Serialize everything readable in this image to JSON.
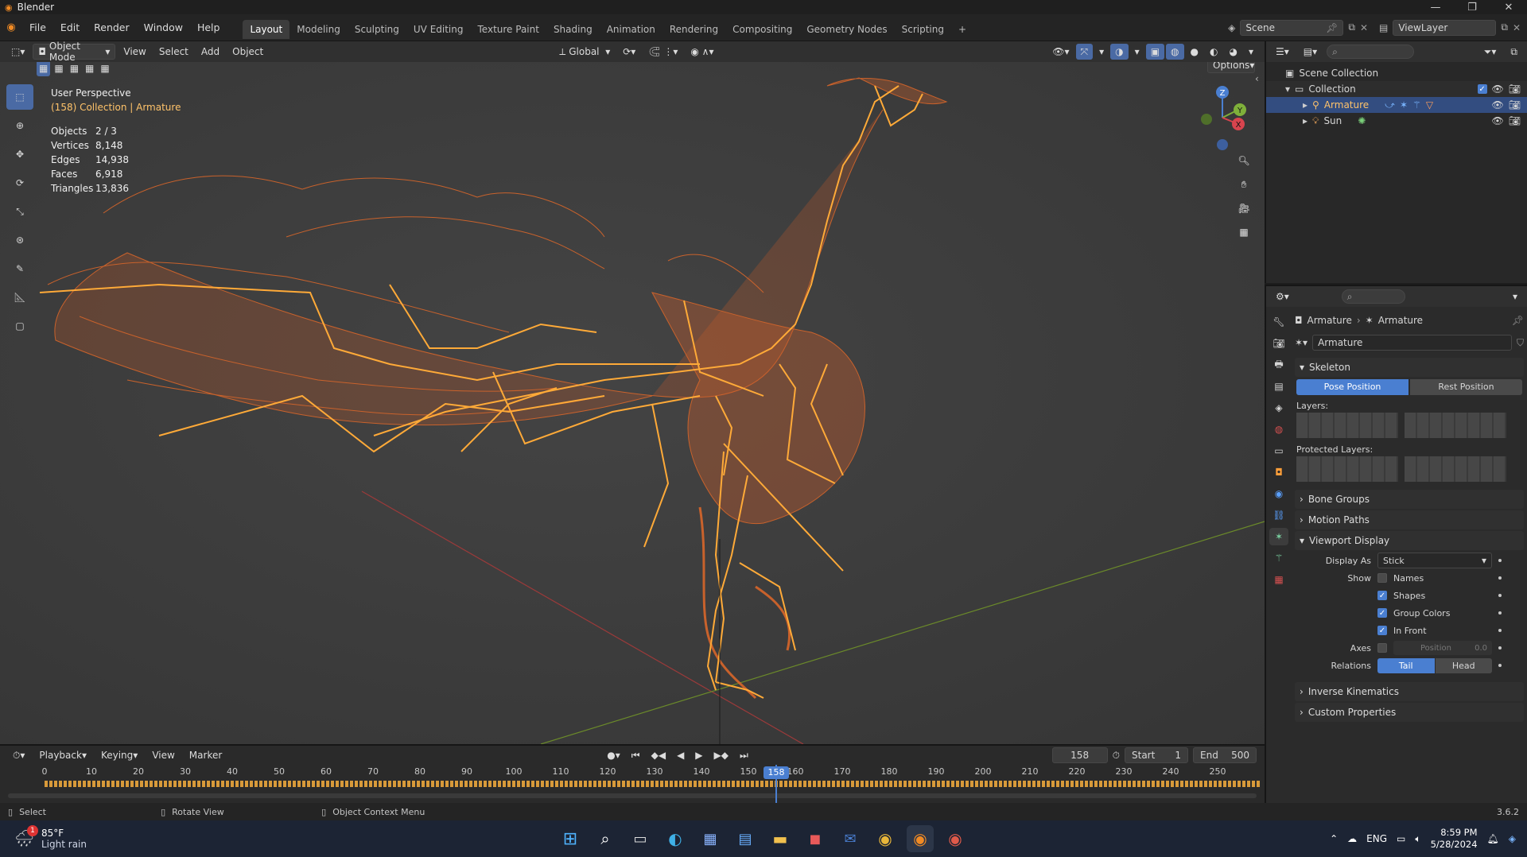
{
  "window": {
    "title": "Blender"
  },
  "menu": {
    "items": [
      "File",
      "Edit",
      "Render",
      "Window",
      "Help"
    ]
  },
  "workspaces": [
    "Layout",
    "Modeling",
    "Sculpting",
    "UV Editing",
    "Texture Paint",
    "Shading",
    "Animation",
    "Rendering",
    "Compositing",
    "Geometry Nodes",
    "Scripting"
  ],
  "scene": {
    "label": "Scene",
    "viewlayer": "ViewLayer"
  },
  "viewport_header": {
    "mode": "Object Mode",
    "view": "View",
    "select": "Select",
    "add": "Add",
    "object": "Object",
    "orientation": "Global",
    "options": "Options"
  },
  "overlay": {
    "title": "User Perspective",
    "context": "(158) Collection | Armature",
    "stats": [
      {
        "k": "Objects",
        "v": "2 / 3"
      },
      {
        "k": "Vertices",
        "v": "8,148"
      },
      {
        "k": "Edges",
        "v": "14,938"
      },
      {
        "k": "Faces",
        "v": "6,918"
      },
      {
        "k": "Triangles",
        "v": "13,836"
      }
    ]
  },
  "gizmo": {
    "z": "Z",
    "y": "Y",
    "x": "X"
  },
  "outliner": {
    "root": "Scene Collection",
    "collection": "Collection",
    "items": [
      {
        "name": "Armature",
        "selected": true
      },
      {
        "name": "Sun",
        "selected": false
      }
    ]
  },
  "properties": {
    "breadcrumb": [
      "Armature",
      "Armature"
    ],
    "data_name": "Armature",
    "skeleton": {
      "title": "Skeleton",
      "pose": "Pose Position",
      "rest": "Rest Position",
      "layers": "Layers:",
      "protected": "Protected Layers:"
    },
    "collapsed": [
      "Bone Groups",
      "Motion Paths"
    ],
    "viewport_display": {
      "title": "Viewport Display",
      "display_as_label": "Display As",
      "display_as": "Stick",
      "show_label": "Show",
      "checks": [
        {
          "label": "Names",
          "on": false
        },
        {
          "label": "Shapes",
          "on": true
        },
        {
          "label": "Group Colors",
          "on": true
        },
        {
          "label": "In Front",
          "on": true
        }
      ],
      "axes_label": "Axes",
      "axes_position_label": "Position",
      "axes_position_value": "0.0",
      "relations_label": "Relations",
      "tail": "Tail",
      "head": "Head"
    },
    "collapsed2": [
      "Inverse Kinematics",
      "Custom Properties"
    ]
  },
  "timeline": {
    "menus": [
      "Playback",
      "Keying",
      "View",
      "Marker"
    ],
    "current": "158",
    "start_label": "Start",
    "start": "1",
    "end_label": "End",
    "end": "500",
    "ticks": [
      "0",
      "10",
      "20",
      "30",
      "40",
      "50",
      "60",
      "70",
      "80",
      "90",
      "100",
      "110",
      "120",
      "130",
      "140",
      "150",
      "160",
      "170",
      "180",
      "190",
      "200",
      "210",
      "220",
      "230",
      "240",
      "250"
    ],
    "playhead": "158"
  },
  "status": {
    "select": "Select",
    "rotate": "Rotate View",
    "context": "Object Context Menu",
    "version": "3.6.2"
  },
  "taskbar": {
    "temp": "85°F",
    "weather": "Light rain",
    "badge": "1",
    "lang": "ENG",
    "time": "8:59 PM",
    "date": "5/28/2024"
  },
  "colors": {
    "accent": "#4a7fd1",
    "wire": "#e0722c",
    "bone": "#ffb040",
    "selected_text": "#ffc36a"
  }
}
